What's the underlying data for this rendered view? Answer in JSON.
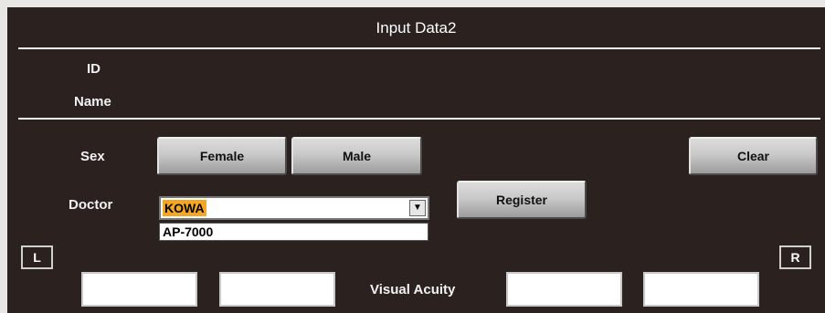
{
  "header": {
    "title": "Input Data2"
  },
  "patient": {
    "id_label": "ID",
    "name_label": "Name"
  },
  "sex": {
    "label": "Sex",
    "female": "Female",
    "male": "Male"
  },
  "actions": {
    "clear": "Clear",
    "register": "Register"
  },
  "doctor": {
    "label": "Doctor",
    "selected": "KOWA",
    "options": [
      "AP-7000"
    ]
  },
  "eyes": {
    "left": "L",
    "right": "R"
  },
  "acuity": {
    "label": "Visual Acuity"
  }
}
